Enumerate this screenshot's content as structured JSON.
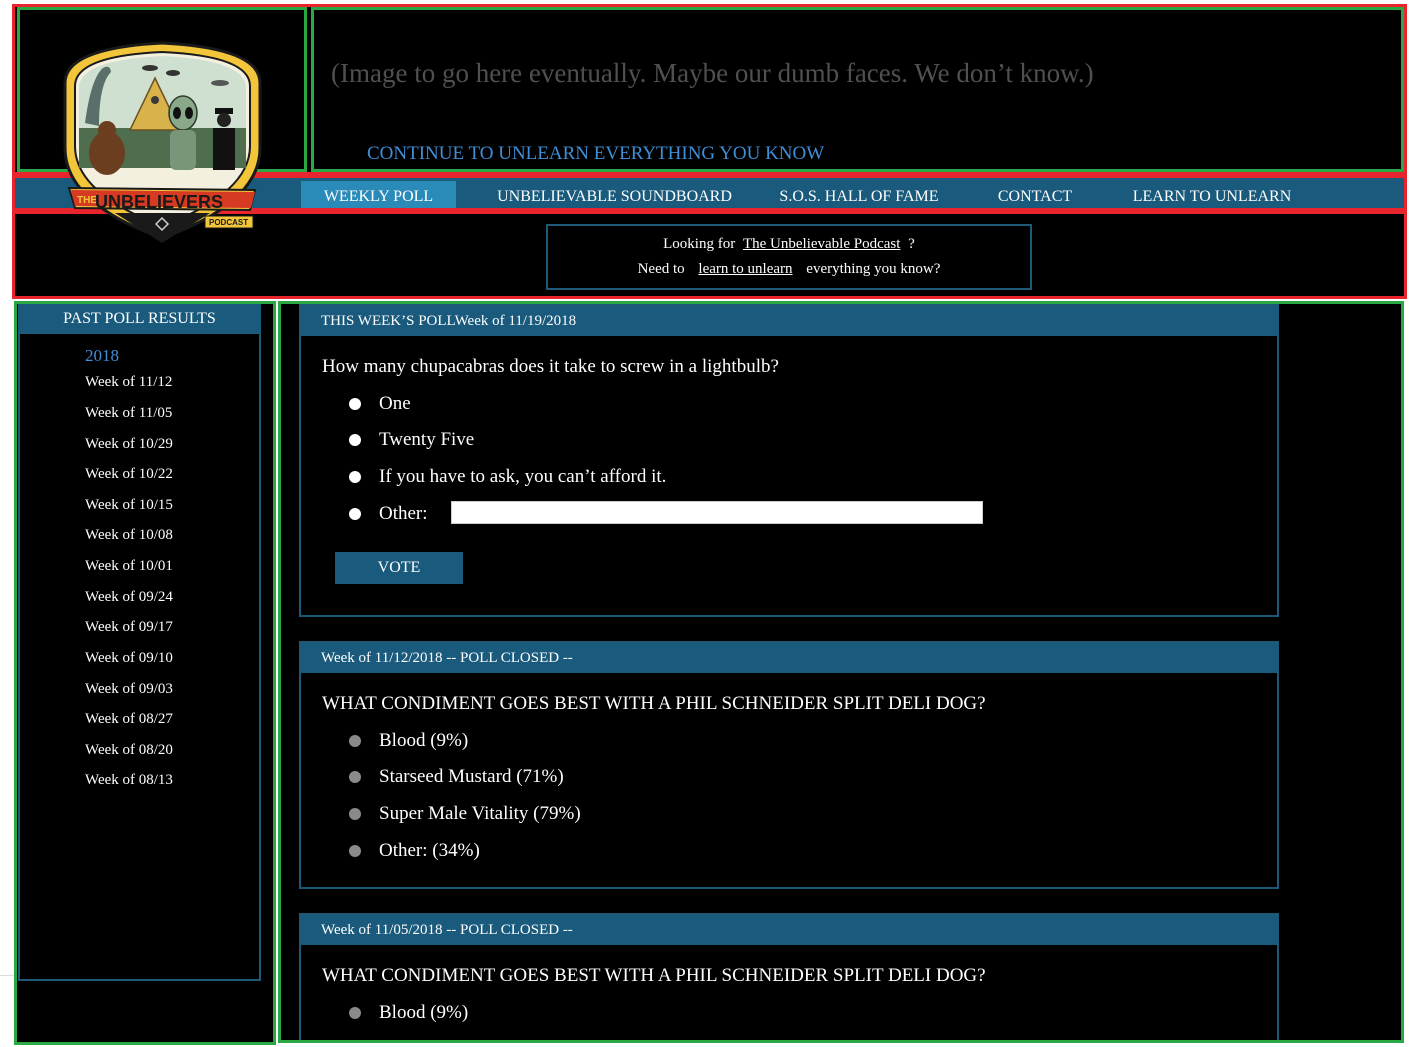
{
  "header": {
    "hero_text": "(Image to go here eventually. Maybe our dumb faces. We don’t know.)",
    "continue_link": "CONTINUE TO UNLEARN EVERYTHING YOU KNOW",
    "logo_lettering": "THE UNBELIEVERS PODCAST"
  },
  "nav": {
    "items": [
      {
        "label": "WEEKLY POLL",
        "active": true
      },
      {
        "label": "UNBELIEVABLE SOUNDBOARD"
      },
      {
        "label": "S.O.S. HALL OF FAME"
      },
      {
        "label": "CONTACT"
      },
      {
        "label": "LEARN TO UNLEARN"
      }
    ]
  },
  "info": {
    "line1_prefix": "Looking for",
    "line1_link": "The Unbelievable Podcast",
    "line1_suffix": "?",
    "line2_prefix": "Need to",
    "line2_link": "learn to unlearn",
    "line2_suffix": "everything you know?"
  },
  "sidebar": {
    "title": "PAST POLL RESULTS",
    "year": "2018",
    "weeks": [
      "Week of 11/12",
      "Week of 11/05",
      "Week of 10/29",
      "Week of 10/22",
      "Week of 10/15",
      "Week of 10/08",
      "Week of 10/01",
      "Week of 09/24",
      "Week of 09/17",
      "Week of 09/10",
      "Week of 09/03",
      "Week of 08/27",
      "Week of 08/20",
      "Week of 08/13"
    ]
  },
  "current_poll": {
    "header": "THIS WEEK’S POLLWeek of 11/19/2018",
    "question": "How many chupacabras does it take to screw in a lightbulb?",
    "options": [
      "One",
      "Twenty Five",
      "If you have to ask, you can’t afford it.",
      "Other:"
    ],
    "other_value": "",
    "vote_label": "VOTE"
  },
  "closed_polls": [
    {
      "header": "Week of 11/12/2018 -- POLL CLOSED --",
      "question": "WHAT CONDIMENT GOES BEST WITH A PHIL SCHNEIDER SPLIT DELI DOG?",
      "options": [
        "Blood (9%)",
        "Starseed Mustard (71%)",
        "Super Male Vitality (79%)",
        "Other: (34%)"
      ]
    },
    {
      "header": "Week of 11/05/2018 -- POLL CLOSED --",
      "question": "WHAT CONDIMENT GOES BEST WITH A PHIL SCHNEIDER SPLIT DELI DOG?",
      "options": [
        "Blood (9%)"
      ]
    }
  ],
  "colors": {
    "nav_bg": "#1a5a7c",
    "nav_active": "#2a8ab8",
    "link_blue": "#3f8fd6",
    "debug_red": "#e8242c",
    "debug_green": "#2aa844"
  }
}
